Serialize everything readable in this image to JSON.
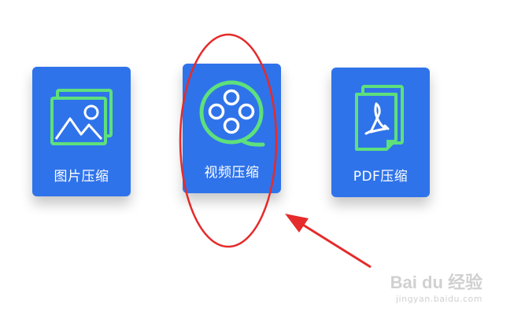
{
  "cards": [
    {
      "label": "图片压缩"
    },
    {
      "label": "视频压缩"
    },
    {
      "label": "PDF压缩"
    }
  ],
  "colors": {
    "card": "#2f73ea",
    "icon_accent": "#5ee07c",
    "annotation": "#e52b2b"
  },
  "icons": [
    "image-icon",
    "film-reel-icon",
    "pdf-document-icon"
  ],
  "watermark": {
    "logo": "Bai du 经验",
    "url": "jingyan.baidu.com"
  }
}
